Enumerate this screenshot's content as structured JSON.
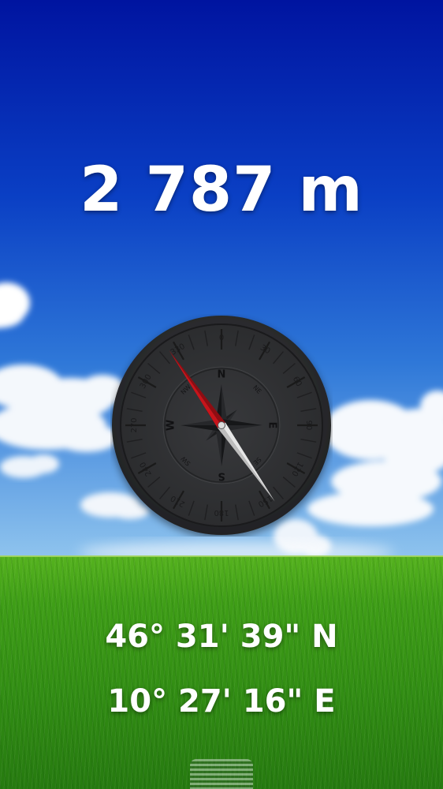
{
  "altitude": {
    "value": "2 787 m"
  },
  "location": {
    "latitude": "46° 31' 39\" N",
    "longitude": "10° 27' 16\" E"
  },
  "compass": {
    "heading_degrees": 325,
    "cardinals": [
      "N",
      "E",
      "S",
      "W"
    ],
    "intercardinals": [
      "NE",
      "SE",
      "SW",
      "NW"
    ],
    "degree_labels": [
      "0",
      "30",
      "60",
      "90",
      "120",
      "150",
      "180",
      "210",
      "240",
      "270",
      "300",
      "330"
    ],
    "needle_north_color": "#c8141b",
    "needle_south_color": "#e6e6e6",
    "dial_color": "#2e2f31"
  },
  "icons": {
    "handle": "drag-handle-icon"
  }
}
